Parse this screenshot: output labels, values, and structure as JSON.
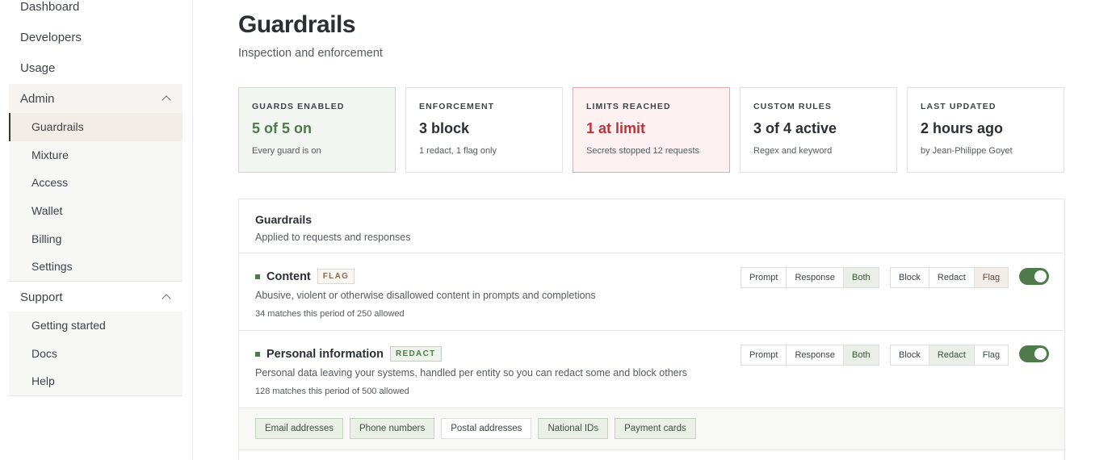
{
  "sidebar": {
    "top_items": [
      "Dashboard",
      "Developers",
      "Usage"
    ],
    "admin": {
      "label": "Admin",
      "items": [
        "Guardrails",
        "Mixture",
        "Access",
        "Wallet",
        "Billing",
        "Settings"
      ]
    },
    "support": {
      "label": "Support",
      "items": [
        "Getting started",
        "Docs",
        "Help"
      ]
    }
  },
  "page": {
    "title": "Guardrails",
    "subtitle": "Inspection and enforcement"
  },
  "stats": [
    {
      "label": "GUARDS ENABLED",
      "value": "5 of 5 on",
      "desc": "Every guard is on"
    },
    {
      "label": "ENFORCEMENT",
      "value": "3 block",
      "desc": "1 redact, 1 flag only"
    },
    {
      "label": "LIMITS REACHED",
      "value": "1 at limit",
      "desc": "Secrets stopped 12 requests"
    },
    {
      "label": "CUSTOM RULES",
      "value": "3 of 4 active",
      "desc": "Regex and keyword"
    },
    {
      "label": "LAST UPDATED",
      "value": "2 hours ago",
      "desc": "by Jean-Philippe Goyet"
    }
  ],
  "panel": {
    "title": "Guardrails",
    "subtitle": "Applied to requests and responses",
    "scope_options": [
      "Prompt",
      "Response",
      "Both"
    ],
    "mode_options": [
      "Block",
      "Redact",
      "Flag"
    ],
    "rows": [
      {
        "name": "Content",
        "tag": "FLAG",
        "desc": "Abusive, violent or otherwise disallowed content in prompts and completions",
        "meta": "34 matches this period of 250 allowed",
        "scope_selected": "Both",
        "mode_selected": "Flag",
        "enabled": true
      },
      {
        "name": "Personal information",
        "tag": "REDACT",
        "desc": "Personal data leaving your systems, handled per entity so you can redact some and block others",
        "meta": "128 matches this period of 500 allowed",
        "scope_selected": "Both",
        "mode_selected": "Redact",
        "enabled": true
      }
    ],
    "entities": [
      "Email addresses",
      "Phone numbers",
      "Postal addresses",
      "National IDs",
      "Payment cards"
    ]
  },
  "colors": {
    "accent_green": "#4f7a4b",
    "alert_red": "#c0323a"
  }
}
